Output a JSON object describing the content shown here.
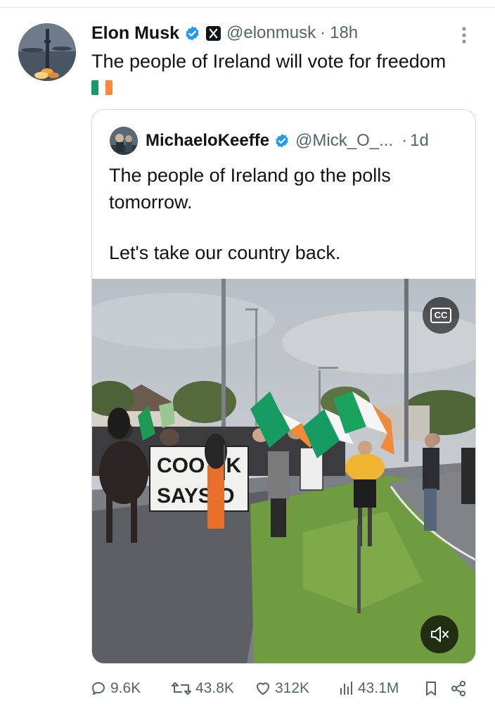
{
  "tweet": {
    "author_name": "Elon Musk",
    "author_handle": "@elonmusk",
    "separator": "·",
    "time": "18h",
    "text": "The people of Ireland will vote for freedom",
    "flag_colors": [
      "#169b62",
      "#ffffff",
      "#ff883e"
    ],
    "verified_color": "#1d9bf0",
    "more_icon": "more-vertical-icon"
  },
  "quote": {
    "author_name": "MichaeloKeeffe",
    "author_handle": "@Mick_O_...",
    "separator": "·",
    "time": "1d",
    "lines": [
      "The people of Ireland go the polls",
      "tomorrow.",
      "Let's take our country back."
    ],
    "media": {
      "type": "video",
      "cc_label": "CC",
      "banner_text_1": "COO  CK",
      "banner_text_2": "SAYS  O",
      "mute_icon": "volume-muted-icon"
    }
  },
  "actions": {
    "replies": "9.6K",
    "reposts": "43.8K",
    "likes": "312K",
    "views": "43.1M"
  }
}
